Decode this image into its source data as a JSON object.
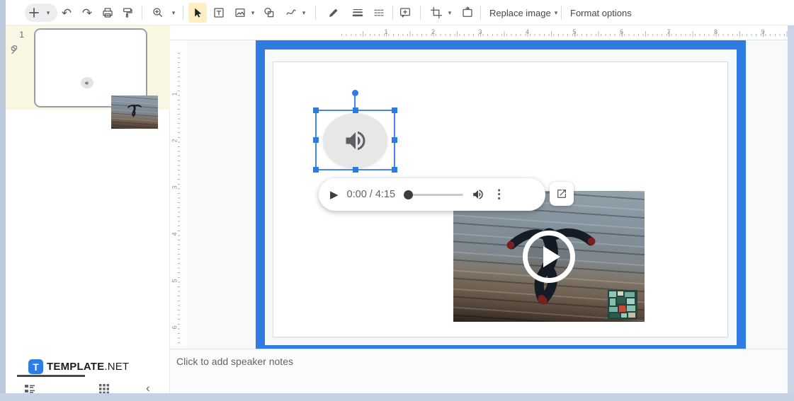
{
  "toolbar": {
    "replace_image": "Replace image",
    "format_options": "Format options",
    "glyphs": {
      "undo": "↶",
      "redo": "↷",
      "dropdown": "▾"
    }
  },
  "rulers": {
    "horizontal": [
      "1",
      "2",
      "3",
      "4",
      "5",
      "6",
      "7",
      "8",
      "9"
    ],
    "vertical": [
      "1",
      "2",
      "3",
      "4",
      "5",
      "6"
    ]
  },
  "filmstrip": {
    "slide_number": "1"
  },
  "audio_player": {
    "play": "▶",
    "time": "0:00 / 4:15",
    "kebab": "⋮"
  },
  "notes": {
    "placeholder": "Click to add speaker notes"
  },
  "brand": {
    "badge": "T",
    "name_bold": "TEMPLATE",
    "name_rest": ".NET"
  },
  "sidebar_footer": {
    "collapse": "‹"
  },
  "colors": {
    "annotation_frame": "#2e7ce2",
    "selection": "#4285f4",
    "brand_blue": "#2e7ce5"
  }
}
